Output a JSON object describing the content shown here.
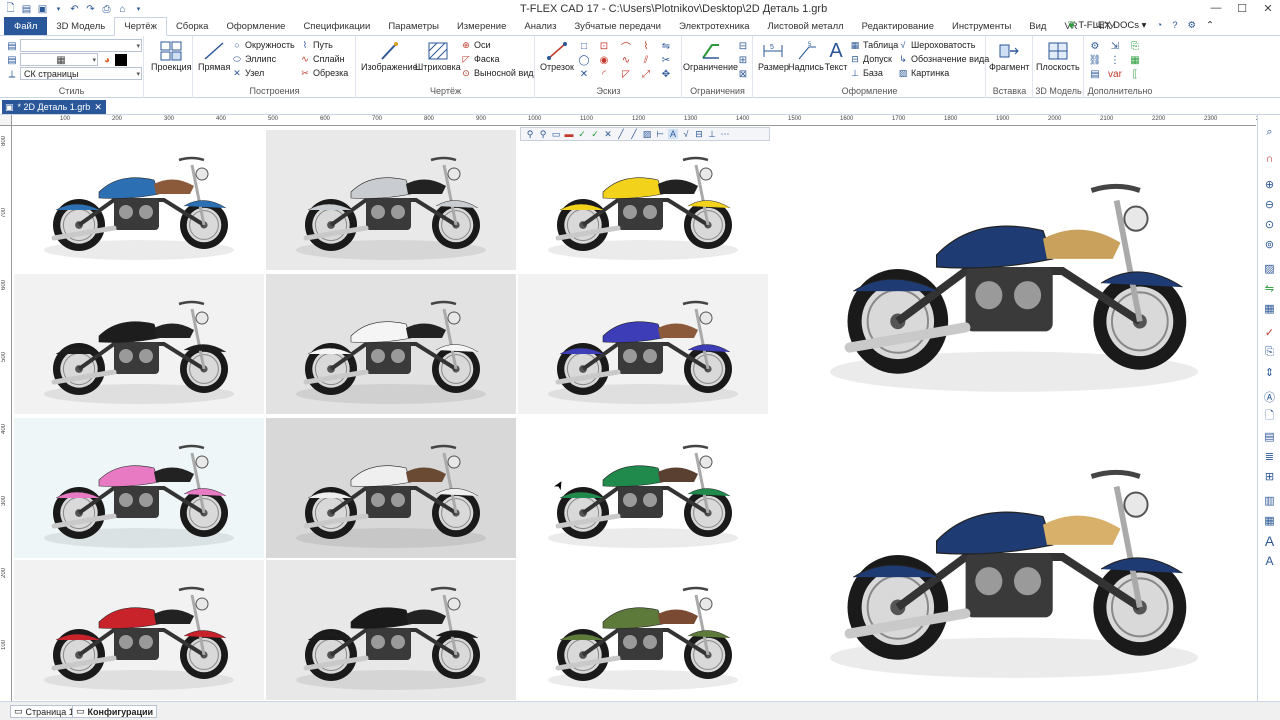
{
  "titlebar": {
    "title": "T-FLEX CAD 17 - C:\\Users\\Plotnikov\\Desktop\\2D Деталь 1.grb",
    "docs_label": "T-FLEX DOCs"
  },
  "tabs": [
    "Файл",
    "3D Модель",
    "Чертёж",
    "Сборка",
    "Оформление",
    "Спецификации",
    "Параметры",
    "Измерение",
    "Анализ",
    "Зубчатые передачи",
    "Электротехника",
    "Листовой металл",
    "Редактирование",
    "Инструменты",
    "Вид",
    "VR",
    "ЧПУ"
  ],
  "active_tab": "Чертёж",
  "ribbon": {
    "style": {
      "label": "Стиль",
      "cs_value": "СК страницы"
    },
    "projection": {
      "label": "Проекция"
    },
    "construction": {
      "label": "Построения",
      "line": "Прямая",
      "circle": "Окружность",
      "ellipse": "Эллипс",
      "node": "Узел",
      "path": "Путь",
      "spline": "Сплайн",
      "trim": "Обрезка"
    },
    "drawing": {
      "label": "Чертёж",
      "image": "Изображение",
      "hatch": "Штриховка",
      "axes": "Оси",
      "chamfer": "Фаска",
      "detail_view": "Выносной вид"
    },
    "sketch": {
      "label": "Эскиз",
      "segment": "Отрезок"
    },
    "constraints": {
      "label": "Ограничения",
      "constraint": "Ограничение"
    },
    "annotation": {
      "label": "Оформление",
      "dimension": "Размер",
      "note": "Надпись",
      "text": "Текст",
      "table": "Таблица",
      "tolerance": "Допуск",
      "base": "База",
      "roughness": "Шероховатость",
      "view_mark": "Обозначение вида",
      "picture": "Картинка"
    },
    "insert": {
      "label": "Вставка",
      "fragment": "Фрагмент"
    },
    "model3d": {
      "label": "3D Модель",
      "plane": "Плоскость"
    },
    "extra": {
      "label": "Дополнительно"
    }
  },
  "document_tab": "* 2D Деталь 1.grb",
  "ruler": {
    "h_labels": [
      "100",
      "200",
      "300",
      "400",
      "500",
      "600",
      "700",
      "800",
      "900",
      "1000",
      "1100",
      "1200",
      "1300",
      "1400",
      "1500",
      "1600",
      "1700",
      "1800",
      "1900",
      "2000",
      "2100",
      "2200",
      "2300",
      "2400"
    ],
    "v_labels": [
      "800",
      "700",
      "600",
      "500",
      "400",
      "300",
      "200",
      "100"
    ]
  },
  "gallery": {
    "tiles": [
      {
        "name": "blue-cruiser",
        "tank": "#2d6fb3",
        "bg": "#ffffff",
        "seat": "#8a5a3b"
      },
      {
        "name": "silver-tourer",
        "tank": "#c9ccd0",
        "bg": "#e9e9e9",
        "seat": "#222222"
      },
      {
        "name": "yellow-cruiser",
        "tank": "#f2d21b",
        "bg": "#ffffff",
        "seat": "#222222"
      },
      {
        "name": "black-cruiser",
        "tank": "#1d1d1d",
        "bg": "#f2f2f2",
        "seat": "#222222"
      },
      {
        "name": "police-tourer",
        "tank": "#f5f5f5",
        "bg": "#e2e2e2",
        "seat": "#222222"
      },
      {
        "name": "purple-bagger",
        "tank": "#3d3db8",
        "bg": "#f2f2f2",
        "seat": "#8a5a3b"
      },
      {
        "name": "pink-cruiser",
        "tank": "#e87ac4",
        "bg": "#eef6f8",
        "seat": "#222222"
      },
      {
        "name": "white-tourer",
        "tank": "#efefef",
        "bg": "#d8d8d8",
        "seat": "#6b4a33"
      },
      {
        "name": "green-bagger",
        "tank": "#1f8a4c",
        "bg": "#ffffff",
        "seat": "#5a4030"
      },
      {
        "name": "red-cruiser",
        "tank": "#c8222a",
        "bg": "#f2f2f2",
        "seat": "#222222"
      },
      {
        "name": "black-classic",
        "tank": "#1a1a1a",
        "bg": "#e8e8e8",
        "seat": "#222222"
      },
      {
        "name": "olive-cruiser",
        "tank": "#5e7a3a",
        "bg": "#ffffff",
        "seat": "#7a4a33"
      }
    ],
    "hero": [
      {
        "name": "chopper-hero-top",
        "tank": "#1f3b73",
        "seat": "#c9a05c"
      },
      {
        "name": "chopper-hero-bottom",
        "tank": "#1f3b73",
        "seat": "#d8b06a"
      }
    ]
  },
  "statusbar": {
    "page_tab": "Страница 1",
    "config_tab": "Конфигурации"
  },
  "colors": {
    "accent": "#2a579a",
    "ribbon_border": "#c9d5e3"
  }
}
